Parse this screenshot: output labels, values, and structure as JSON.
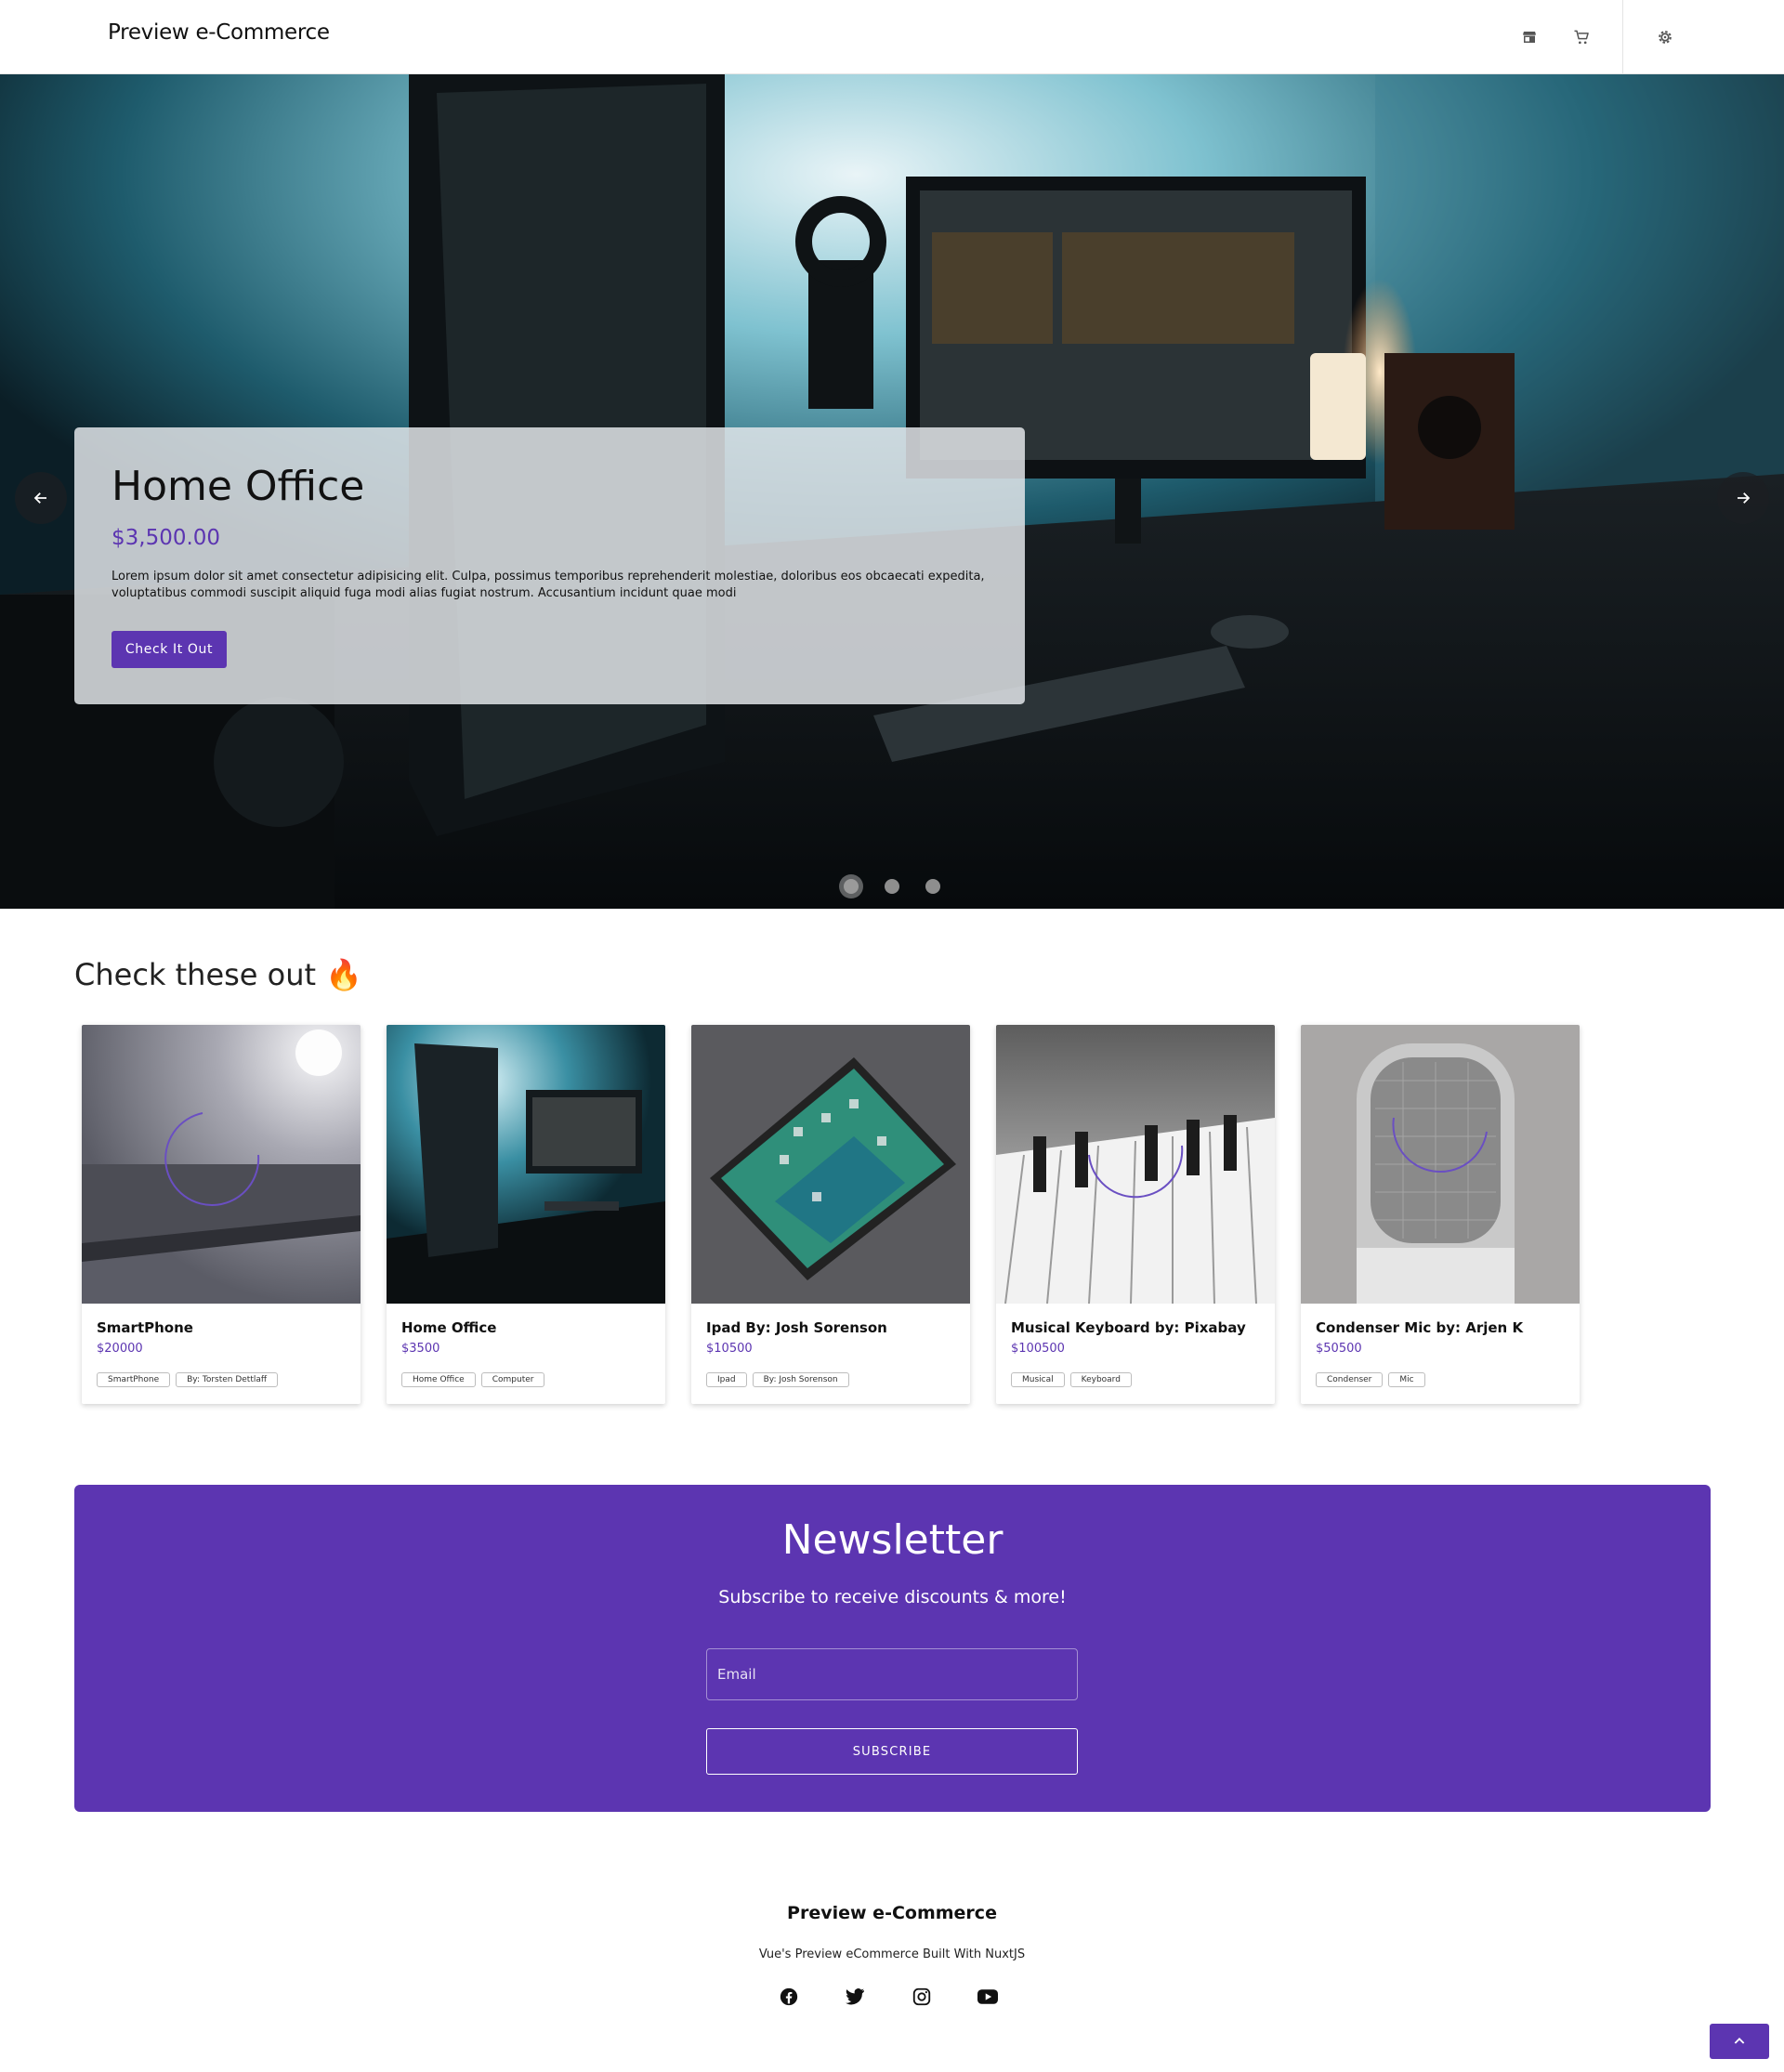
{
  "header": {
    "brand": "Preview e-Commerce",
    "icons": [
      "store-icon",
      "cart-icon",
      "settings-icon"
    ]
  },
  "hero": {
    "title": "Home Office",
    "price": "$3,500.00",
    "description": "Lorem ipsum dolor sit amet consectetur adipisicing elit. Culpa, possimus temporibus reprehenderit molestiae, doloribus eos obcaecati expedita, voluptatibus commodi suscipit aliquid fuga modi alias fugiat nostrum. Accusantium incidunt quae modi",
    "button_label": "Check It Out",
    "slide_count": 3,
    "active_slide": 1
  },
  "featured": {
    "title": "Check these out 🔥",
    "products": [
      {
        "name": "SmartPhone",
        "price": "$20000",
        "tags": [
          "SmartPhone",
          "By: Torsten Dettlaff"
        ]
      },
      {
        "name": "Home Office",
        "price": "$3500",
        "tags": [
          "Home Office",
          "Computer"
        ]
      },
      {
        "name": "Ipad By: Josh Sorenson",
        "price": "$10500",
        "tags": [
          "Ipad",
          "By: Josh Sorenson"
        ]
      },
      {
        "name": "Musical Keyboard by: Pixabay",
        "price": "$100500",
        "tags": [
          "Musical",
          "Keyboard"
        ]
      },
      {
        "name": "Condenser Mic by: Arjen K",
        "price": "$50500",
        "tags": [
          "Condenser",
          "Mic"
        ]
      }
    ]
  },
  "newsletter": {
    "title": "Newsletter",
    "subtitle": "Subscribe to receive discounts & more!",
    "email_placeholder": "Email",
    "email_value": "",
    "button_label": "SUBSCRIBE"
  },
  "footer": {
    "brand": "Preview e-Commerce",
    "tagline": "Vue's Preview eCommerce Built With NuxtJS",
    "social": [
      "facebook-icon",
      "twitter-icon",
      "instagram-icon",
      "youtube-icon"
    ]
  },
  "colors": {
    "accent": "#5c35b1"
  }
}
